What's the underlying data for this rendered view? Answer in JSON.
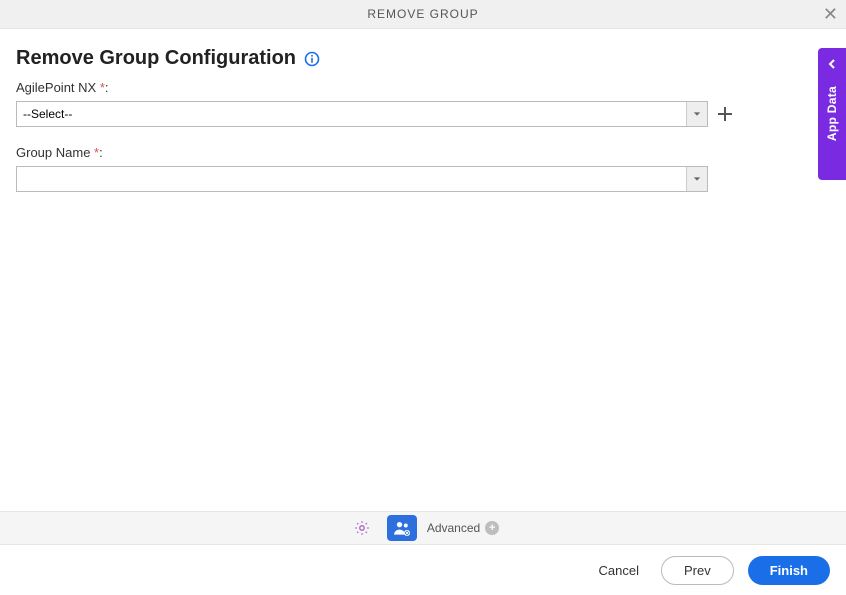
{
  "header": {
    "title": "REMOVE GROUP"
  },
  "page": {
    "title": "Remove Group Configuration"
  },
  "fields": {
    "agilepoint": {
      "label": "AgilePoint NX",
      "value": "--Select--"
    },
    "groupname": {
      "label": "Group Name",
      "value": ""
    }
  },
  "tabs": {
    "advanced_label": "Advanced"
  },
  "footer": {
    "cancel": "Cancel",
    "prev": "Prev",
    "finish": "Finish"
  },
  "side": {
    "label": "App Data"
  }
}
